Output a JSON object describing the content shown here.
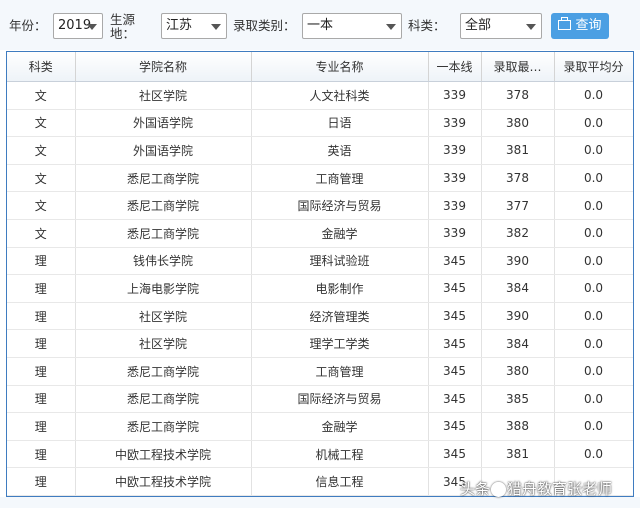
{
  "filters": {
    "year_label": "年份：",
    "year_value": "2019",
    "source_label": "生源\n地：",
    "source_value": "江苏",
    "category_label": "录取类别：",
    "category_value": "一本",
    "subject_label": "科类：",
    "subject_value": "全部",
    "query_button": "查询"
  },
  "table": {
    "columns": [
      "科类",
      "学院名称",
      "专业名称",
      "一本线",
      "录取最…",
      "录取平均分"
    ],
    "rows": [
      [
        "文",
        "社区学院",
        "人文社科类",
        "339",
        "378",
        "0.0"
      ],
      [
        "文",
        "外国语学院",
        "日语",
        "339",
        "380",
        "0.0"
      ],
      [
        "文",
        "外国语学院",
        "英语",
        "339",
        "381",
        "0.0"
      ],
      [
        "文",
        "悉尼工商学院",
        "工商管理",
        "339",
        "378",
        "0.0"
      ],
      [
        "文",
        "悉尼工商学院",
        "国际经济与贸易",
        "339",
        "377",
        "0.0"
      ],
      [
        "文",
        "悉尼工商学院",
        "金融学",
        "339",
        "382",
        "0.0"
      ],
      [
        "理",
        "钱伟长学院",
        "理科试验班",
        "345",
        "390",
        "0.0"
      ],
      [
        "理",
        "上海电影学院",
        "电影制作",
        "345",
        "384",
        "0.0"
      ],
      [
        "理",
        "社区学院",
        "经济管理类",
        "345",
        "390",
        "0.0"
      ],
      [
        "理",
        "社区学院",
        "理学工学类",
        "345",
        "384",
        "0.0"
      ],
      [
        "理",
        "悉尼工商学院",
        "工商管理",
        "345",
        "380",
        "0.0"
      ],
      [
        "理",
        "悉尼工商学院",
        "国际经济与贸易",
        "345",
        "385",
        "0.0"
      ],
      [
        "理",
        "悉尼工商学院",
        "金融学",
        "345",
        "388",
        "0.0"
      ],
      [
        "理",
        "中欧工程技术学院",
        "机械工程",
        "345",
        "381",
        "0.0"
      ],
      [
        "理",
        "中欧工程技术学院",
        "信息工程",
        "345",
        "",
        ""
      ]
    ]
  },
  "watermark": {
    "text_before": "头条",
    "text_after": "猎舟教育张老师"
  }
}
